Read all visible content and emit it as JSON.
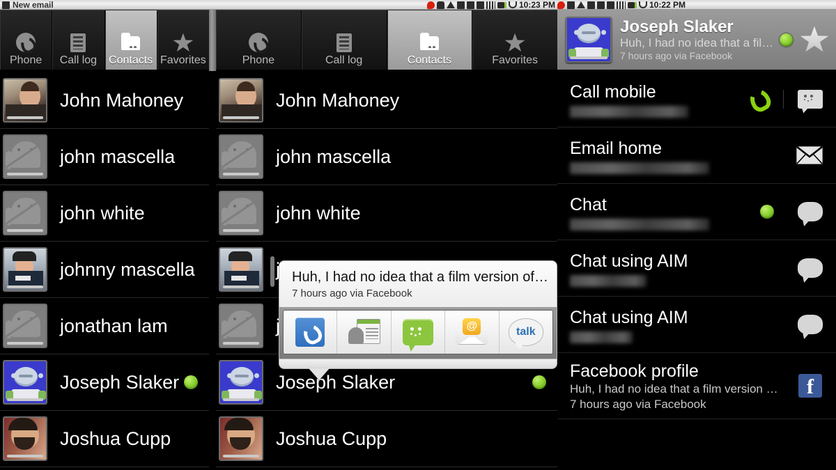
{
  "statusbar": {
    "left_notification": "New email",
    "left_icon": "photo-icon",
    "clock_left": "10:23 PM",
    "clock_right": "10:22 PM",
    "icons": [
      "notification-count-icon",
      "message-icon",
      "download-icon",
      "sync-icon",
      "camera-icon",
      "sdcard-icon",
      "signal-icon",
      "battery-icon",
      "bag-icon"
    ]
  },
  "tabs": [
    {
      "label": "Phone",
      "icon": "phone-icon",
      "active": false
    },
    {
      "label": "Call log",
      "icon": "call-log-icon",
      "active": false
    },
    {
      "label": "Contacts",
      "icon": "contacts-folder-icon",
      "active": true
    },
    {
      "label": "Favorites",
      "icon": "star-icon",
      "active": false
    }
  ],
  "contacts": [
    {
      "name": "John Mahoney",
      "avatar": "photo-mahoney",
      "presence": false
    },
    {
      "name": "john mascella",
      "avatar": "android-default",
      "presence": false
    },
    {
      "name": "john white",
      "avatar": "android-default",
      "presence": false
    },
    {
      "name": "johnny mascella",
      "avatar": "photo-johnny",
      "presence": false
    },
    {
      "name": "jonathan lam",
      "avatar": "android-default",
      "presence": false
    },
    {
      "name": "Joseph Slaker",
      "avatar": "photo-joseph",
      "presence": true
    },
    {
      "name": "Joshua Cupp",
      "avatar": "photo-joshua",
      "presence": false
    }
  ],
  "quick_contact": {
    "status": "Huh, I had no idea that a film version of…",
    "meta": "7 hours ago via Facebook",
    "actions": [
      {
        "name": "dialer-action",
        "icon": "phone-dialer-icon"
      },
      {
        "name": "contact-action",
        "icon": "contact-card-icon"
      },
      {
        "name": "sms-action",
        "icon": "sms-bubble-icon"
      },
      {
        "name": "email-action",
        "icon": "email-at-icon"
      },
      {
        "name": "talk-action",
        "icon": "google-talk-icon",
        "label": "talk"
      }
    ]
  },
  "detail": {
    "name": "Joseph Slaker",
    "status": "Huh, I had no idea that a film …",
    "meta": "7 hours ago via Facebook",
    "presence_online": true,
    "star": "favorite-star-icon",
    "rows": [
      {
        "title": "Call mobile",
        "sub_redacted": true,
        "sub": "",
        "sub2": "",
        "icons": [
          {
            "name": "call-icon",
            "glyph": "call-green"
          },
          {
            "name": "sms-icon",
            "glyph": "sms"
          }
        ]
      },
      {
        "title": "Email home",
        "sub_redacted": true,
        "sub": "",
        "sub2": "",
        "icons": [
          {
            "name": "email-icon",
            "glyph": "mail"
          }
        ]
      },
      {
        "title": "Chat",
        "sub_redacted": true,
        "sub": "",
        "sub2": "",
        "presence_online": true,
        "icons": [
          {
            "name": "chat-icon",
            "glyph": "bubble"
          }
        ]
      },
      {
        "title": "Chat using AIM",
        "sub_redacted": true,
        "sub": "",
        "sub2": "",
        "icons": [
          {
            "name": "chat-icon",
            "glyph": "bubble"
          }
        ]
      },
      {
        "title": "Chat using AIM",
        "sub_redacted": true,
        "sub": "",
        "sub2": "",
        "icons": [
          {
            "name": "chat-icon",
            "glyph": "bubble"
          }
        ]
      },
      {
        "title": "Facebook profile",
        "sub_redacted": false,
        "sub": "Huh, I had no idea that a film version …",
        "sub2": "7 hours ago via Facebook",
        "icons": [
          {
            "name": "facebook-icon",
            "glyph": "fb",
            "text": "f"
          }
        ]
      }
    ]
  },
  "colors": {
    "accent_green": "#8cd211",
    "facebook_blue": "#3b5998",
    "tab_active": "#b4b4b4",
    "background": "#000000"
  }
}
